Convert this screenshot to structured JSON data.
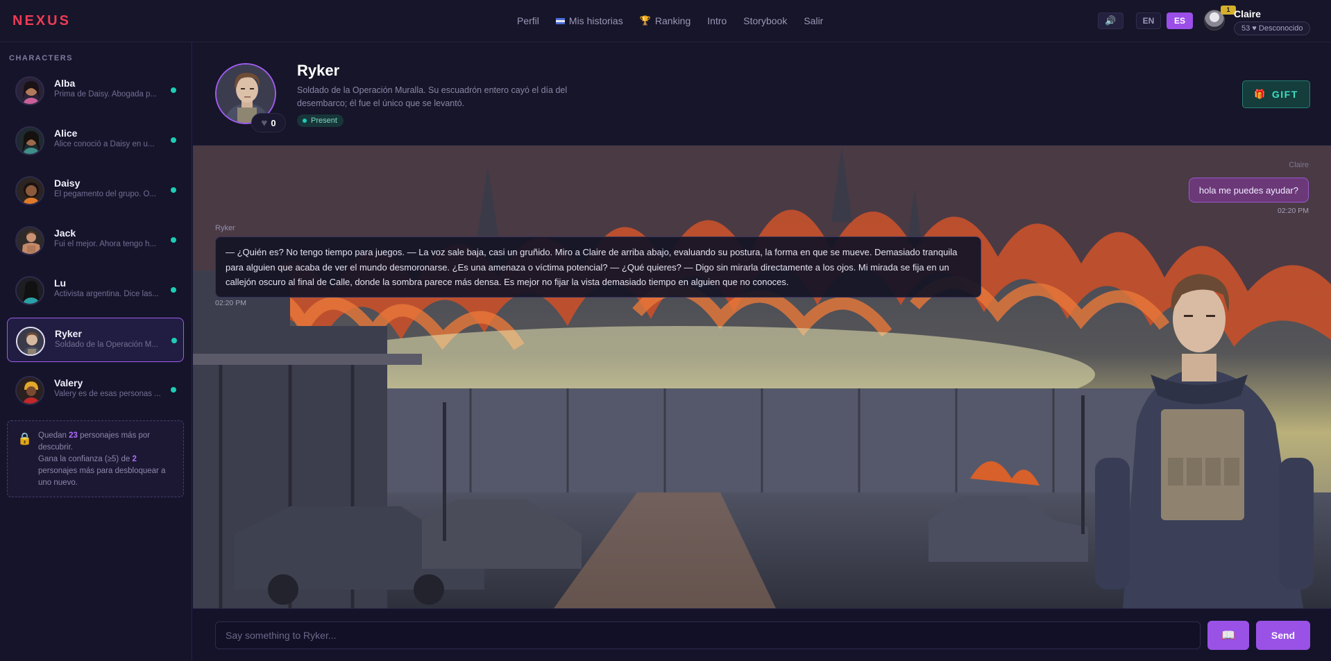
{
  "app": {
    "logo": "NEXUS"
  },
  "nav": {
    "items": [
      {
        "label": "Perfil",
        "icon": ""
      },
      {
        "label": "Mis historias",
        "icon": "flag-icon"
      },
      {
        "label": "Ranking",
        "icon": "trophy-icon"
      },
      {
        "label": "Intro",
        "icon": ""
      },
      {
        "label": "Storybook",
        "icon": ""
      },
      {
        "label": "Salir",
        "icon": ""
      }
    ]
  },
  "header_controls": {
    "sound_icon": "speaker-icon",
    "lang_en": "EN",
    "lang_es": "ES",
    "active_lang": "ES"
  },
  "user": {
    "name": "Claire",
    "badge": "1",
    "status": "53 ♥ Desconocido"
  },
  "sidebar": {
    "title": "CHARACTERS",
    "characters": [
      {
        "name": "Alba",
        "desc": "Prima de Daisy. Abogada p...",
        "online": true
      },
      {
        "name": "Alice",
        "desc": "Alice conoció a Daisy en u...",
        "online": true
      },
      {
        "name": "Daisy",
        "desc": "El pegamento del grupo. O...",
        "online": true
      },
      {
        "name": "Jack",
        "desc": "Fui el mejor. Ahora tengo h...",
        "online": true
      },
      {
        "name": "Lu",
        "desc": "Activista argentina. Dice las...",
        "online": true
      },
      {
        "name": "Ryker",
        "desc": "Soldado de la Operación M...",
        "online": true,
        "active": true
      },
      {
        "name": "Valery",
        "desc": "Valery es de esas personas ...",
        "online": true
      }
    ],
    "unlock": {
      "prefix": "Quedan",
      "remaining": "23",
      "line1_suffix": "personajes más por descubrir.",
      "line2_prefix": "Gana la confianza (≥5) de",
      "needed": "2",
      "line2_suffix": "personajes más para desbloquear a uno nuevo."
    }
  },
  "character": {
    "name": "Ryker",
    "description": "Soldado de la Operación Muralla. Su escuadrón entero cayó el día del desembarco; él fue el único que se levantó.",
    "hearts": "0",
    "status": "Present",
    "gift_label": "GIFT"
  },
  "chat": {
    "messages": [
      {
        "sender": "Claire",
        "text": "hola me puedes ayudar?",
        "time": "02:20 PM",
        "side": "right"
      },
      {
        "sender": "Ryker",
        "text": "— ¿Quién es? No tengo tiempo para juegos. — La voz sale baja, casi un gruñido. Miro a Claire de arriba abajo, evaluando su postura, la forma en que se mueve. Demasiado tranquila para alguien que acaba de ver el mundo desmoronarse. ¿Es una amenaza o víctima potencial? — ¿Qué quieres? — Digo sin mirarla directamente a los ojos. Mi mirada se fija en un callejón oscuro al final de Calle, donde la sombra parece más densa. Es mejor no fijar la vista demasiado tiempo en alguien que no conoces.",
        "time": "02:20 PM",
        "side": "left"
      }
    ]
  },
  "input": {
    "placeholder": "Say something to Ryker...",
    "send_label": "Send",
    "storybook_icon": "book-icon"
  },
  "colors": {
    "accent": "#9a52e6",
    "brand": "#ef3b55",
    "online": "#1ecdb4",
    "gift": "#3fe0c3"
  }
}
